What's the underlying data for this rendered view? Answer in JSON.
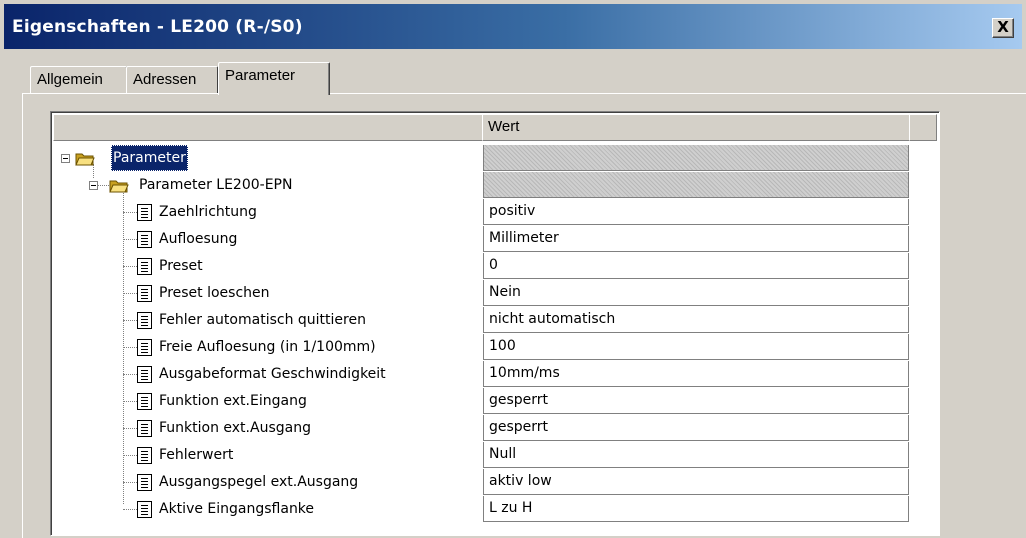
{
  "window": {
    "title": "Eigenschaften - LE200 (R-/S0)",
    "close_label": "X"
  },
  "tabs": [
    {
      "label": "Allgemein"
    },
    {
      "label": "Adressen"
    },
    {
      "label": "Parameter"
    }
  ],
  "grid": {
    "header_name": "",
    "header_value": "Wert",
    "root": {
      "label": "Parameter"
    },
    "group": {
      "label": "Parameter LE200-EPN"
    },
    "params": [
      {
        "name": "Zaehlrichtung",
        "value": "positiv"
      },
      {
        "name": "Aufloesung",
        "value": "Millimeter"
      },
      {
        "name": "Preset",
        "value": "0"
      },
      {
        "name": "Preset loeschen",
        "value": "Nein"
      },
      {
        "name": "Fehler automatisch quittieren",
        "value": "nicht automatisch"
      },
      {
        "name": "Freie Aufloesung (in 1/100mm)",
        "value": "100"
      },
      {
        "name": "Ausgabeformat Geschwindigkeit",
        "value": "10mm/ms"
      },
      {
        "name": "Funktion ext.Eingang",
        "value": "gesperrt"
      },
      {
        "name": "Funktion ext.Ausgang",
        "value": "gesperrt"
      },
      {
        "name": "Fehlerwert",
        "value": "Null"
      },
      {
        "name": "Ausgangspegel ext.Ausgang",
        "value": "aktiv low"
      },
      {
        "name": "Aktive Eingangsflanke",
        "value": "L zu H"
      }
    ]
  },
  "icons": {
    "expander": "collapse-minus-icon",
    "folder": "open-folder-icon",
    "parameter": "document-list-icon"
  },
  "colors": {
    "title_gradient_start": "#0a246a",
    "title_gradient_end": "#a6caf0",
    "selection": "#0a246a",
    "dialog_face": "#d4d0c8"
  }
}
